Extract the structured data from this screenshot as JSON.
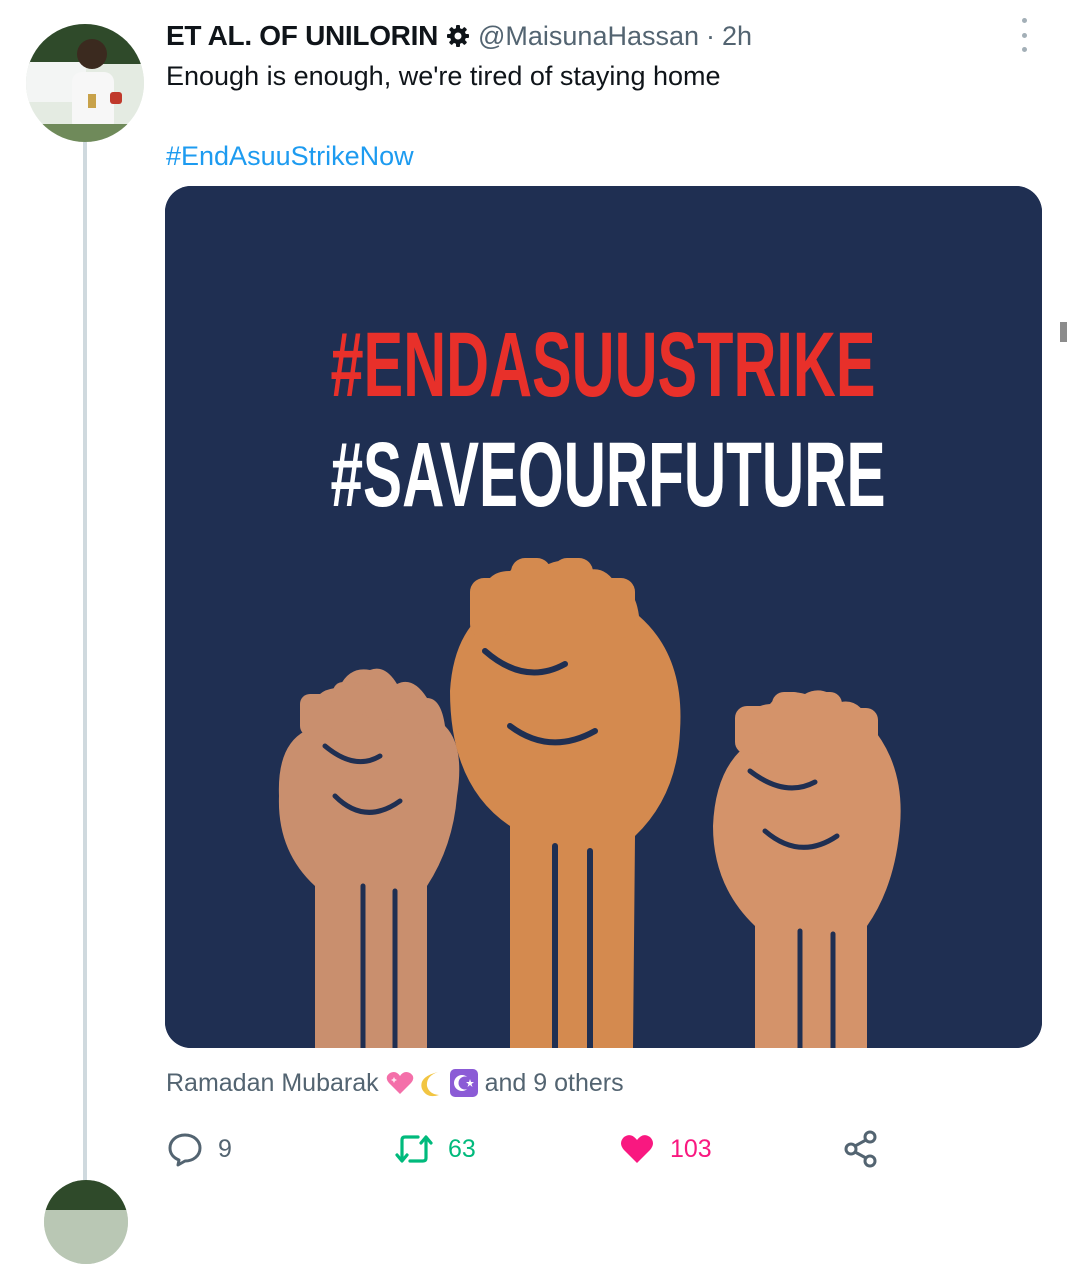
{
  "tweet": {
    "display_name": "ET AL. OF UNILORIN",
    "verified_icon": "gear-badge-icon",
    "handle": "@MaisunaHassan",
    "separator": "·",
    "time": "2h",
    "text": "Enough is enough, we're tired of staying home",
    "hashtag": "#EndAsuuStrikeNow",
    "image": {
      "line1": "#ENDASUUSTRIKE",
      "line2": "#SAVEOURFUTURE",
      "background": "#1f2f52",
      "line1_color": "#e8302a",
      "line2_color": "#ffffff"
    },
    "reactions": {
      "prefix": "Ramadan Mubarak",
      "emojis": [
        "sparkling-heart-icon",
        "crescent-moon-icon",
        "star-and-crescent-icon"
      ],
      "suffix": "and 9 others"
    },
    "actions": {
      "replies": "9",
      "retweets": "63",
      "likes": "103"
    }
  },
  "colors": {
    "link": "#1d9bf0",
    "retweet": "#00ba7c",
    "like": "#f91880",
    "muted": "#536471"
  }
}
